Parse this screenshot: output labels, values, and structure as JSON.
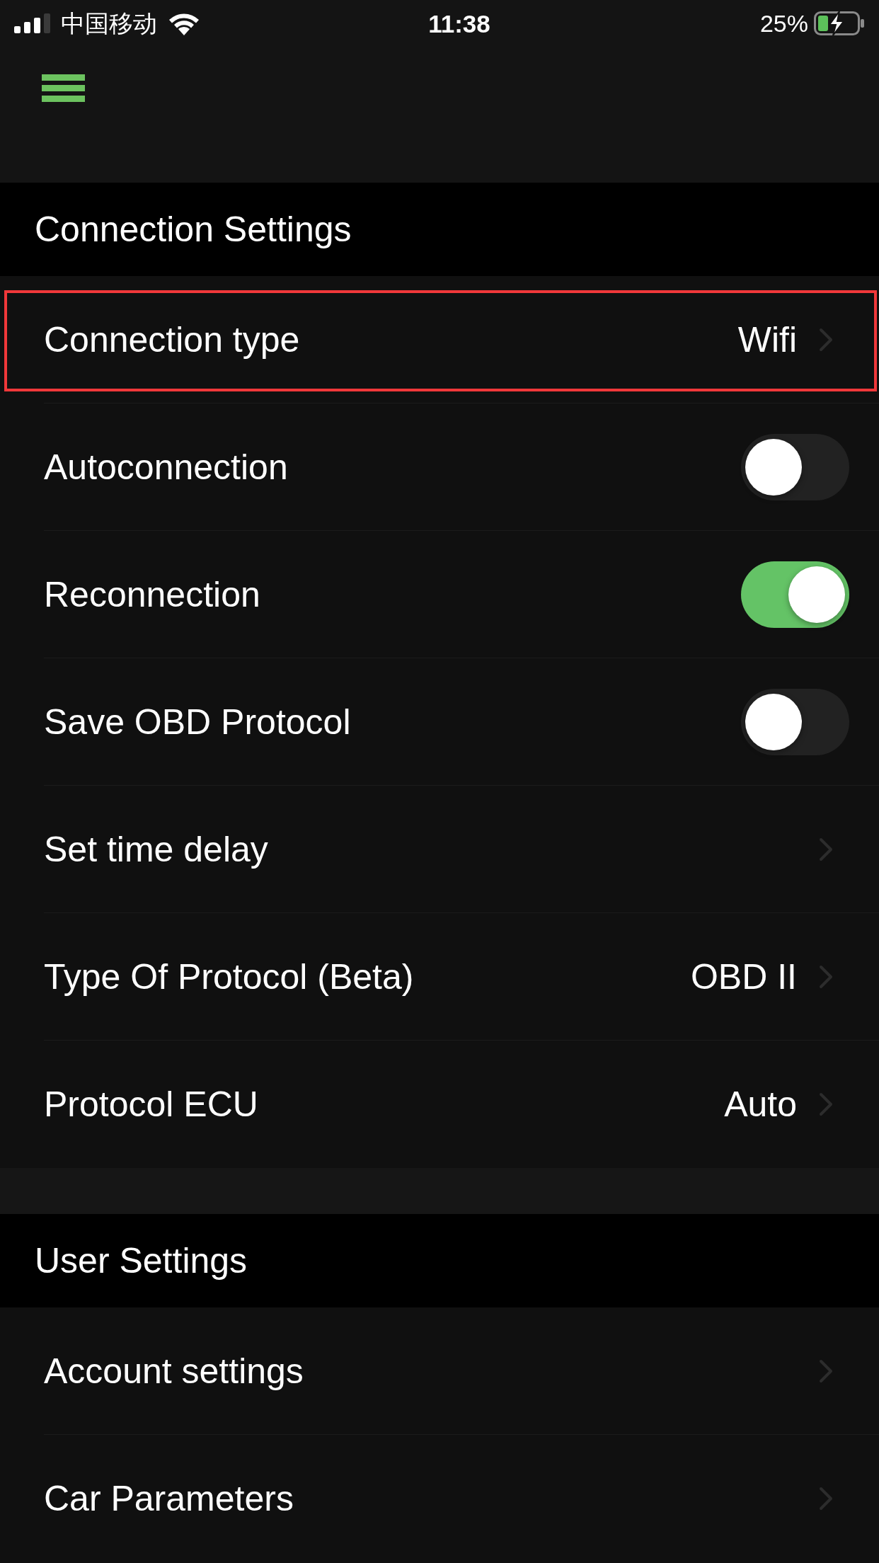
{
  "status_bar": {
    "carrier": "中国移动",
    "time": "11:38",
    "battery": "25%"
  },
  "sections": [
    {
      "title": "Connection Settings",
      "rows": [
        {
          "kind": "link",
          "label": "Connection type",
          "value": "Wifi",
          "highlighted": true
        },
        {
          "kind": "toggle",
          "label": "Autoconnection",
          "on": false
        },
        {
          "kind": "toggle",
          "label": "Reconnection",
          "on": true
        },
        {
          "kind": "toggle",
          "label": "Save OBD Protocol",
          "on": false
        },
        {
          "kind": "link",
          "label": "Set time delay"
        },
        {
          "kind": "link",
          "label": "Type Of Protocol (Beta)",
          "value": "OBD II"
        },
        {
          "kind": "link",
          "label": "Protocol ECU",
          "value": "Auto"
        }
      ]
    },
    {
      "title": "User Settings",
      "rows": [
        {
          "kind": "link",
          "label": "Account settings"
        },
        {
          "kind": "link",
          "label": "Car Parameters"
        }
      ]
    }
  ]
}
